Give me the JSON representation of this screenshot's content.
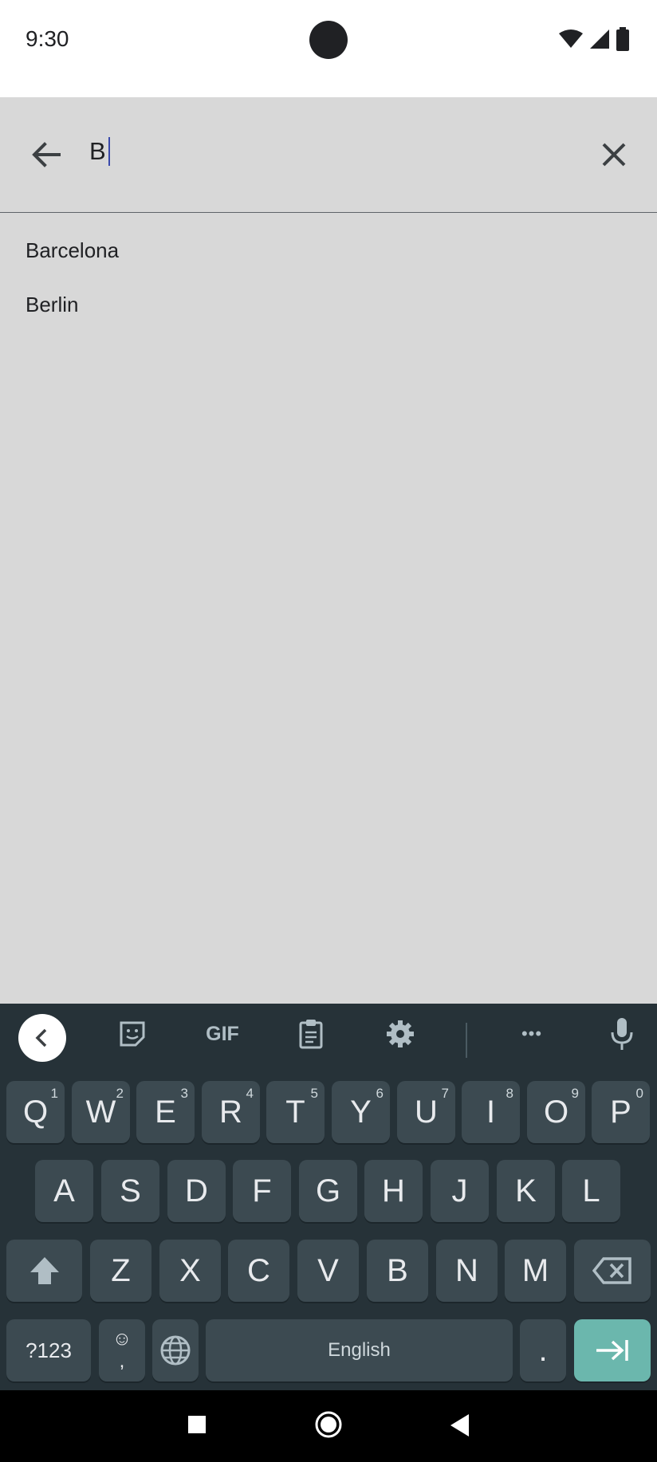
{
  "status": {
    "time": "9:30"
  },
  "search": {
    "query": "B"
  },
  "suggestions": [
    "Barcelona",
    "Berlin"
  ],
  "keyboard": {
    "toolbar": [
      "collapse-icon",
      "sticker-icon",
      "GIF",
      "clipboard-icon",
      "settings-icon",
      "more-icon",
      "mic-icon"
    ],
    "gif_label": "GIF",
    "more_label": "•••",
    "row1": [
      {
        "k": "Q",
        "n": "1"
      },
      {
        "k": "W",
        "n": "2"
      },
      {
        "k": "E",
        "n": "3"
      },
      {
        "k": "R",
        "n": "4"
      },
      {
        "k": "T",
        "n": "5"
      },
      {
        "k": "Y",
        "n": "6"
      },
      {
        "k": "U",
        "n": "7"
      },
      {
        "k": "I",
        "n": "8"
      },
      {
        "k": "O",
        "n": "9"
      },
      {
        "k": "P",
        "n": "0"
      }
    ],
    "row2": [
      "A",
      "S",
      "D",
      "F",
      "G",
      "H",
      "J",
      "K",
      "L"
    ],
    "row3": [
      "Z",
      "X",
      "C",
      "V",
      "B",
      "N",
      "M"
    ],
    "symbols_label": "?123",
    "emoji_label": "☺",
    "comma_label": ",",
    "space_label": "English",
    "period_label": "."
  }
}
